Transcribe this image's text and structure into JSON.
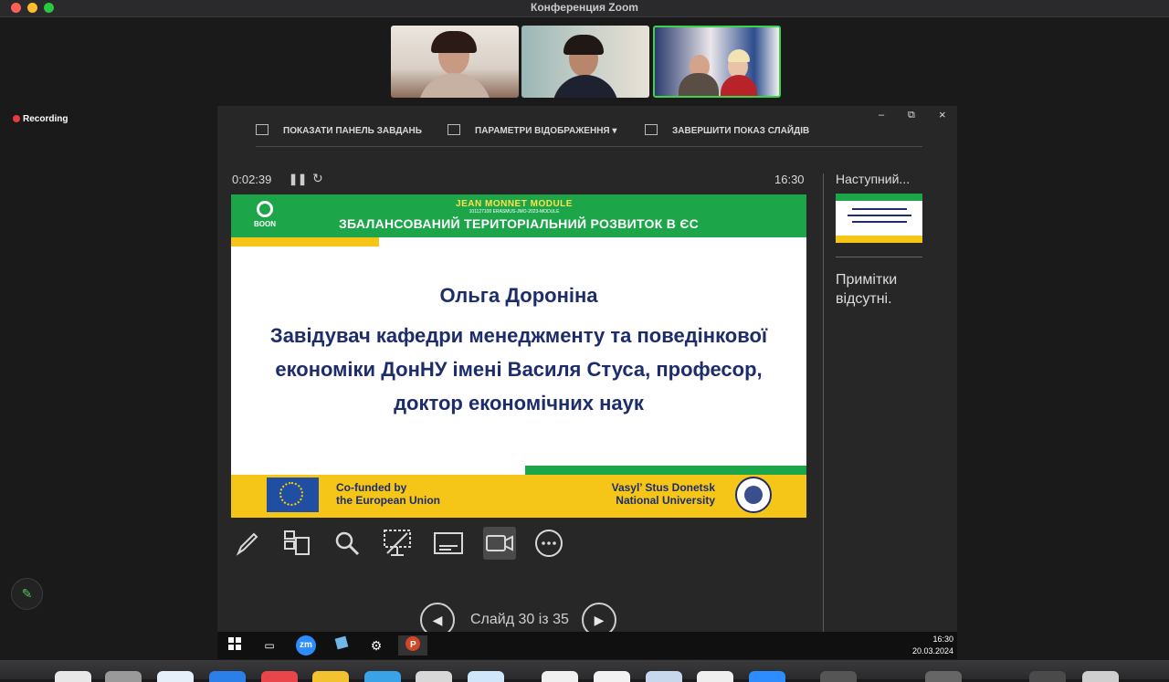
{
  "window": {
    "title": "Конференция Zoom"
  },
  "recording": {
    "label": "Recording"
  },
  "presenter": {
    "toolbar": {
      "show_taskbar": "ПОКАЗАТИ ПАНЕЛЬ ЗАВДАНЬ",
      "display_settings": "ПАРАМЕТРИ ВІДОБРАЖЕННЯ ▾",
      "end_show": "ЗАВЕРШИТИ ПОКАЗ СЛАЙДІВ"
    },
    "window_controls": {
      "minimize": "–",
      "restore": "⧉",
      "close": "×"
    },
    "timer": "0:02:39",
    "clock": "16:30",
    "next_label": "Наступний...",
    "notes": "Примітки відсутні.",
    "slide_counter": "Слайд 30 із 35"
  },
  "slide": {
    "logo_text": "BOON",
    "module": "JEAN MONNET MODULE",
    "module_id": "101127100 ERASMUS-JMO-2023-MODULE",
    "title": "ЗБАЛАНСОВАНИЙ ТЕРИТОРІАЛЬНИЙ РОЗВИТОК В ЄС",
    "name": "Ольга Дороніна",
    "description": "Завідувач кафедри менеджменту та поведінкової економіки ДонНУ імені Василя Стуса, професор, доктор економічних наук",
    "cofunded_1": "Co-funded by",
    "cofunded_2": "the European Union",
    "university_1": "Vasyl’ Stus Donetsk",
    "university_2": "National University"
  },
  "taskbar": {
    "time": "16:30",
    "date": "20.03.2024",
    "zoom_label": "zm"
  },
  "colors": {
    "green": "#1da54a",
    "yellow": "#f5c518",
    "navy": "#1d2d6b",
    "active_speaker": "#3fd14b"
  },
  "icons": [
    "pen-icon",
    "slides-grid-icon",
    "magnifier-icon",
    "laser-pointer-icon",
    "subtitles-icon",
    "camera-icon",
    "more-icon"
  ]
}
